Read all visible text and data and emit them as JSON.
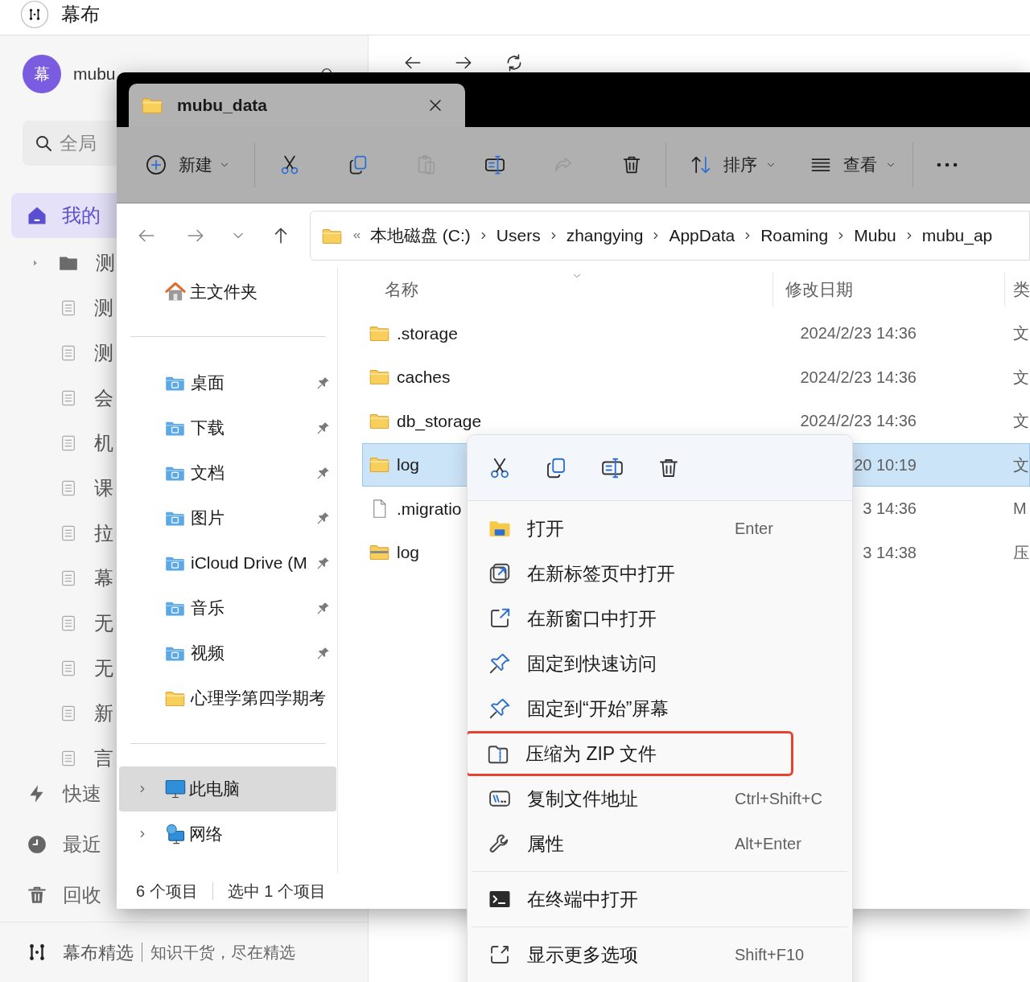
{
  "app": {
    "title": "幕布",
    "user": {
      "avatar": "幕",
      "name": "mubu"
    },
    "search": {
      "placeholder": "全局"
    },
    "home": {
      "label": "我的",
      "selected": true
    },
    "tree": [
      {
        "kind": "folder",
        "label": "测"
      },
      {
        "kind": "doc",
        "label": "测"
      },
      {
        "kind": "doc",
        "label": "测"
      },
      {
        "kind": "doc",
        "label": "会"
      },
      {
        "kind": "doc",
        "label": "机"
      },
      {
        "kind": "doc",
        "label": "课"
      },
      {
        "kind": "doc",
        "label": "拉"
      },
      {
        "kind": "doc",
        "label": "幕"
      },
      {
        "kind": "doc",
        "label": "无"
      },
      {
        "kind": "doc",
        "label": "无"
      },
      {
        "kind": "doc",
        "label": "新"
      },
      {
        "kind": "doc",
        "label": "言"
      }
    ],
    "bottom_nav": [
      {
        "kind": "quick",
        "label": "快速"
      },
      {
        "kind": "recent",
        "label": "最近"
      },
      {
        "kind": "trash",
        "label": "回收"
      }
    ],
    "footer": {
      "brand": "幕布精选",
      "tagline": "知识干货，尽在精选"
    }
  },
  "explorer": {
    "tab": {
      "title": "mubu_data"
    },
    "toolbar": [
      {
        "kind": "new",
        "label": "新建",
        "disabled": false
      },
      {
        "kind": "cut",
        "disabled": false
      },
      {
        "kind": "copy",
        "disabled": false
      },
      {
        "kind": "paste",
        "disabled": true
      },
      {
        "kind": "rename",
        "disabled": false
      },
      {
        "kind": "share",
        "disabled": true
      },
      {
        "kind": "delete",
        "disabled": false
      },
      {
        "kind": "sort",
        "label": "排序",
        "disabled": false
      },
      {
        "kind": "view",
        "label": "查看",
        "disabled": false
      },
      {
        "kind": "more",
        "disabled": false
      }
    ],
    "breadcrumb": [
      "本地磁盘 (C:)",
      "Users",
      "zhangying",
      "AppData",
      "Roaming",
      "Mubu",
      "mubu_ap"
    ],
    "nav_pane": {
      "home": "主文件夹",
      "quick_access": [
        {
          "kind": "desktop",
          "label": "桌面",
          "pinned": true
        },
        {
          "kind": "downloads",
          "label": "下载",
          "pinned": true
        },
        {
          "kind": "documents",
          "label": "文档",
          "pinned": true
        },
        {
          "kind": "pictures",
          "label": "图片",
          "pinned": true
        },
        {
          "kind": "icloud",
          "label": "iCloud Drive (M",
          "pinned": true
        },
        {
          "kind": "music",
          "label": "音乐",
          "pinned": true
        },
        {
          "kind": "videos",
          "label": "视频",
          "pinned": true
        },
        {
          "kind": "folder",
          "label": "心理学第四学期考",
          "pinned": false
        }
      ],
      "locations": [
        {
          "kind": "pc",
          "label": "此电脑",
          "selected": true
        },
        {
          "kind": "network",
          "label": "网络",
          "selected": false
        }
      ]
    },
    "columns": [
      "名称",
      "修改日期",
      "类"
    ],
    "rows": [
      {
        "kind": "folder",
        "name": ".storage",
        "modified": "2024/2/23 14:36",
        "type": "文",
        "selected": false
      },
      {
        "kind": "folder",
        "name": "caches",
        "modified": "2024/2/23 14:36",
        "type": "文",
        "selected": false
      },
      {
        "kind": "folder",
        "name": "db_storage",
        "modified": "2024/2/23 14:36",
        "type": "文",
        "selected": false
      },
      {
        "kind": "folder",
        "name": "log",
        "modified": "20 10:19",
        "type": "文",
        "selected": true
      },
      {
        "kind": "file",
        "name": ".migratio",
        "modified": "3 14:36",
        "type": "M",
        "selected": false
      },
      {
        "kind": "zip",
        "name": "log",
        "modified": "3 14:38",
        "type": "压",
        "selected": false
      }
    ],
    "status_bar": {
      "count": "6 个项目",
      "selection": "选中 1 个项目"
    }
  },
  "context_menu": {
    "quick_actions": [
      {
        "kind": "cut"
      },
      {
        "kind": "copy"
      },
      {
        "kind": "rename"
      },
      {
        "kind": "delete"
      }
    ],
    "sections": [
      [
        {
          "kind": "open",
          "label": "打开",
          "shortcut": "Enter",
          "highlighted": false
        },
        {
          "kind": "new-tab",
          "label": "在新标签页中打开",
          "highlighted": false
        },
        {
          "kind": "new-window",
          "label": "在新窗口中打开",
          "highlighted": false
        },
        {
          "kind": "pin",
          "label": "固定到快速访问",
          "highlighted": false
        },
        {
          "kind": "pin",
          "label": "固定到“开始”屏幕",
          "highlighted": false
        },
        {
          "kind": "zip",
          "label": "压缩为 ZIP 文件",
          "highlighted": true
        },
        {
          "kind": "copy-path",
          "label": "复制文件地址",
          "shortcut": "Ctrl+Shift+C",
          "highlighted": false
        },
        {
          "kind": "properties",
          "label": "属性",
          "shortcut": "Alt+Enter",
          "highlighted": false
        }
      ],
      [
        {
          "kind": "terminal",
          "label": "在终端中打开",
          "highlighted": false
        }
      ],
      [
        {
          "kind": "more",
          "label": "显示更多选项",
          "shortcut": "Shift+F10",
          "highlighted": false
        }
      ]
    ]
  }
}
